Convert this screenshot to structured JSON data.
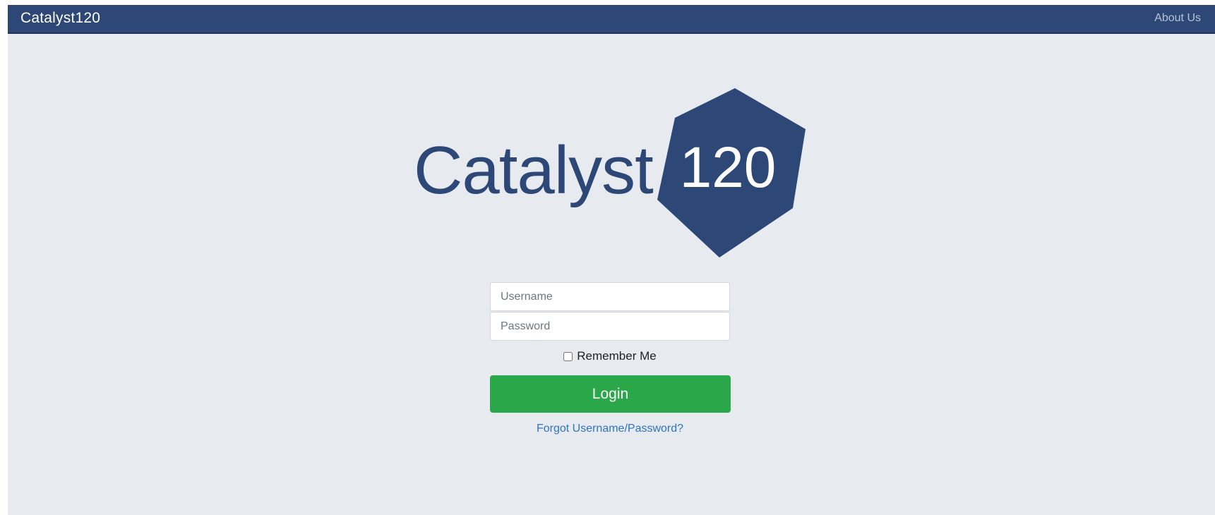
{
  "navbar": {
    "brand": "Catalyst120",
    "about_link": "About Us",
    "background_color": "#2d4776"
  },
  "logo": {
    "wordmark": "Catalyst",
    "badge_number": "120",
    "brand_color": "#2d4776"
  },
  "login_form": {
    "username_placeholder": "Username",
    "password_placeholder": "Password",
    "remember_label": "Remember Me",
    "remember_checked": false,
    "login_label": "Login",
    "login_color": "#2aa849",
    "forgot_link": "Forgot Username/Password?"
  }
}
